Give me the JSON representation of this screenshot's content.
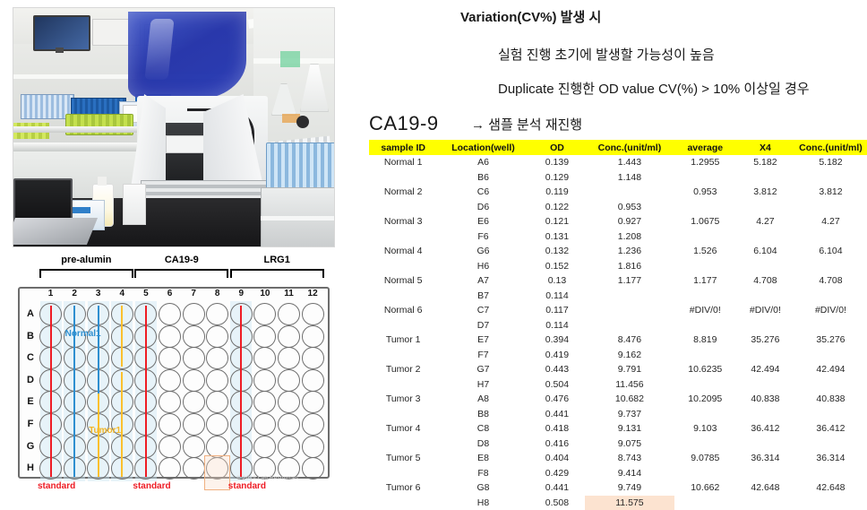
{
  "slide": {
    "heading": "Variation(CV%) 발생 시",
    "bullet_1": "실험 진행 초기에 발생할 가능성이 높음",
    "bullet_2": "Duplicate 진행한 OD value CV(%) > 10% 이상일 경우",
    "assay_label": "CA19-9",
    "action": "→ 샘플 분석 재진행"
  },
  "photo": {
    "caption": "laboratory automated ELISA instrument with blue lid"
  },
  "plate": {
    "brackets": [
      {
        "label": "pre-alumin",
        "from_col": 1,
        "to_col": 4
      },
      {
        "label": "CA19-9",
        "from_col": 5,
        "to_col": 8
      },
      {
        "label": "LRG1",
        "from_col": 9,
        "to_col": 12
      }
    ],
    "columns": [
      "1",
      "2",
      "3",
      "4",
      "5",
      "6",
      "7",
      "8",
      "9",
      "10",
      "11",
      "12"
    ],
    "rows": [
      "A",
      "B",
      "C",
      "D",
      "E",
      "F",
      "G",
      "H"
    ],
    "standard_label": "standard",
    "standard_columns": [
      1,
      5,
      9
    ],
    "tint_columns": [
      1,
      2,
      3,
      4,
      5,
      9
    ],
    "sample_tags": [
      {
        "text": "Normal1",
        "type": "normal"
      },
      {
        "text": "Tumor1",
        "type": "tumor"
      }
    ],
    "marker_colors": {
      "standard": "#ee1c25",
      "normal": "#2e8fd0",
      "tumor": "#fbc02d"
    },
    "highlight_well": "H8",
    "watermark": "© 2019 Lab Resources"
  },
  "table": {
    "headers": [
      "sample ID",
      "Location(well)",
      "OD",
      "Conc.(unit/ml)",
      "average",
      "X4",
      "Conc.(unit/ml)"
    ],
    "header_bg": "#ffff00",
    "highlight_bg": "#fce3d0",
    "rows": [
      {
        "sample": "Normal 1",
        "loc": "A6",
        "od": "0.139",
        "conc": "1.443",
        "avg": "1.2955",
        "x4": "5.182",
        "conc2": "5.182"
      },
      {
        "sample": "",
        "loc": "B6",
        "od": "0.129",
        "conc": "1.148",
        "avg": "",
        "x4": "",
        "conc2": ""
      },
      {
        "sample": "Normal 2",
        "loc": "C6",
        "od": "0.119",
        "conc": "",
        "avg": "0.953",
        "x4": "3.812",
        "conc2": "3.812"
      },
      {
        "sample": "",
        "loc": "D6",
        "od": "0.122",
        "conc": "0.953",
        "avg": "",
        "x4": "",
        "conc2": ""
      },
      {
        "sample": "Normal 3",
        "loc": "E6",
        "od": "0.121",
        "conc": "0.927",
        "avg": "1.0675",
        "x4": "4.27",
        "conc2": "4.27"
      },
      {
        "sample": "",
        "loc": "F6",
        "od": "0.131",
        "conc": "1.208",
        "avg": "",
        "x4": "",
        "conc2": ""
      },
      {
        "sample": "Normal 4",
        "loc": "G6",
        "od": "0.132",
        "conc": "1.236",
        "avg": "1.526",
        "x4": "6.104",
        "conc2": "6.104"
      },
      {
        "sample": "",
        "loc": "H6",
        "od": "0.152",
        "conc": "1.816",
        "avg": "",
        "x4": "",
        "conc2": ""
      },
      {
        "sample": "Normal 5",
        "loc": "A7",
        "od": "0.13",
        "conc": "1.177",
        "avg": "1.177",
        "x4": "4.708",
        "conc2": "4.708"
      },
      {
        "sample": "",
        "loc": "B7",
        "od": "0.114",
        "conc": "",
        "avg": "",
        "x4": "",
        "conc2": ""
      },
      {
        "sample": "Normal 6",
        "loc": "C7",
        "od": "0.117",
        "conc": "",
        "avg": "#DIV/0!",
        "x4": "#DIV/0!",
        "conc2": "#DIV/0!"
      },
      {
        "sample": "",
        "loc": "D7",
        "od": "0.114",
        "conc": "",
        "avg": "",
        "x4": "",
        "conc2": ""
      },
      {
        "sample": "Tumor 1",
        "loc": "E7",
        "od": "0.394",
        "conc": "8.476",
        "avg": "8.819",
        "x4": "35.276",
        "conc2": "35.276"
      },
      {
        "sample": "",
        "loc": "F7",
        "od": "0.419",
        "conc": "9.162",
        "avg": "",
        "x4": "",
        "conc2": ""
      },
      {
        "sample": "Tumor 2",
        "loc": "G7",
        "od": "0.443",
        "conc": "9.791",
        "avg": "10.6235",
        "x4": "42.494",
        "conc2": "42.494"
      },
      {
        "sample": "",
        "loc": "H7",
        "od": "0.504",
        "conc": "11.456",
        "avg": "",
        "x4": "",
        "conc2": ""
      },
      {
        "sample": "Tumor 3",
        "loc": "A8",
        "od": "0.476",
        "conc": "10.682",
        "avg": "10.2095",
        "x4": "40.838",
        "conc2": "40.838"
      },
      {
        "sample": "",
        "loc": "B8",
        "od": "0.441",
        "conc": "9.737",
        "avg": "",
        "x4": "",
        "conc2": ""
      },
      {
        "sample": "Tumor 4",
        "loc": "C8",
        "od": "0.418",
        "conc": "9.131",
        "avg": "9.103",
        "x4": "36.412",
        "conc2": "36.412"
      },
      {
        "sample": "",
        "loc": "D8",
        "od": "0.416",
        "conc": "9.075",
        "avg": "",
        "x4": "",
        "conc2": ""
      },
      {
        "sample": "Tumor 5",
        "loc": "E8",
        "od": "0.404",
        "conc": "8.743",
        "avg": "9.0785",
        "x4": "36.314",
        "conc2": "36.314"
      },
      {
        "sample": "",
        "loc": "F8",
        "od": "0.429",
        "conc": "9.414",
        "avg": "",
        "x4": "",
        "conc2": ""
      },
      {
        "sample": "Tumor 6",
        "loc": "G8",
        "od": "0.441",
        "conc": "9.749",
        "avg": "10.662",
        "x4": "42.648",
        "conc2": "42.648"
      },
      {
        "sample": "",
        "loc": "H8",
        "od": "0.508",
        "conc": "11.575",
        "avg": "",
        "x4": "",
        "conc2": "",
        "conc_highlight": true
      }
    ]
  }
}
